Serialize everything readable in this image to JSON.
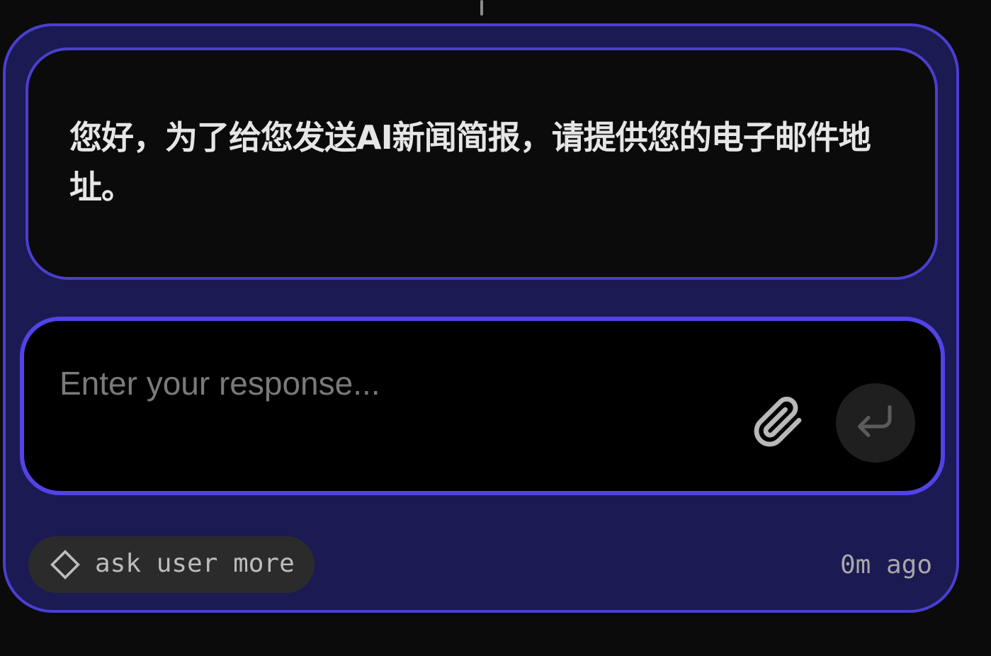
{
  "message": {
    "text": "您好，为了给您发送AI新闻简报，请提供您的电子邮件地址。"
  },
  "response": {
    "placeholder": "Enter your response...",
    "value": ""
  },
  "icons": {
    "attach": "paperclip-icon",
    "send": "enter-return-icon",
    "chip": "diamond-icon"
  },
  "tool": {
    "label": "ask user more"
  },
  "status": {
    "time": "0m ago"
  },
  "colors": {
    "card_background": "#1c1a52",
    "card_border": "#4a3fd0",
    "input_border": "#5143e6",
    "page_background": "#0b0b0b"
  }
}
